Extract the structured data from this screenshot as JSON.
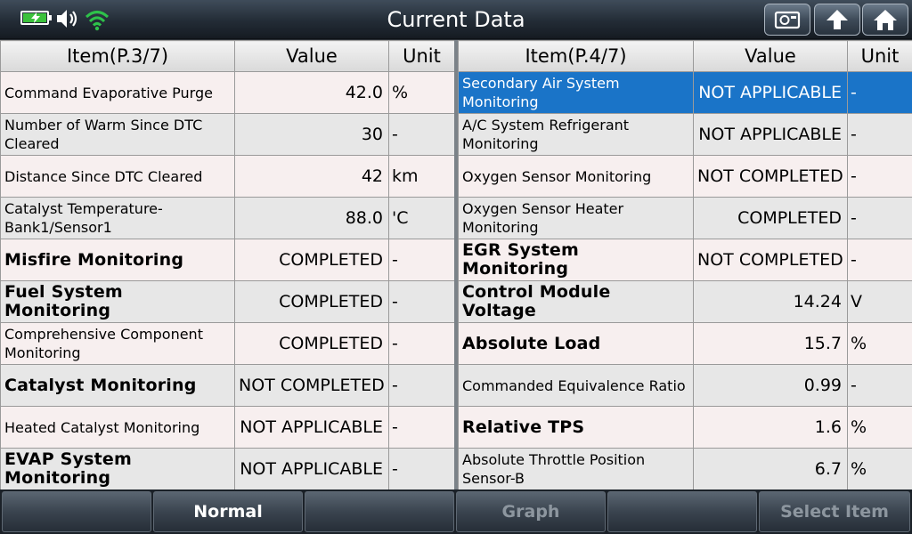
{
  "title": "Current Data",
  "status_icons": {
    "battery": "battery-charging-icon",
    "speaker": "speaker-icon",
    "wifi": "wifi-icon"
  },
  "toolbar_icons": [
    "camera-icon",
    "up-arrow-icon",
    "home-icon"
  ],
  "colors": {
    "selected_row": "#1a74c8",
    "battery_fill": "#3cc23c",
    "wifi": "#2ec24a"
  },
  "left_table": {
    "headers": {
      "item": "Item(P.3/7)",
      "value": "Value",
      "unit": "Unit"
    },
    "rows": [
      {
        "item": "Command Evaporative Purge",
        "value": "42.0",
        "unit": "%"
      },
      {
        "item": "Number of Warm Since DTC Cleared",
        "value": "30",
        "unit": "-"
      },
      {
        "item": "Distance Since DTC Cleared",
        "value": "42",
        "unit": "km"
      },
      {
        "item": "Catalyst Temperature-Bank1/Sensor1",
        "value": "88.0",
        "unit": "'C"
      },
      {
        "item": "Misfire Monitoring",
        "value": "COMPLETED",
        "unit": "-"
      },
      {
        "item": "Fuel System Monitoring",
        "value": "COMPLETED",
        "unit": "-"
      },
      {
        "item": "Comprehensive Component Monitoring",
        "value": "COMPLETED",
        "unit": "-"
      },
      {
        "item": "Catalyst Monitoring",
        "value": "NOT COMPLETED",
        "unit": "-"
      },
      {
        "item": "Heated Catalyst Monitoring",
        "value": "NOT APPLICABLE",
        "unit": "-"
      },
      {
        "item": "EVAP System Monitoring",
        "value": "NOT APPLICABLE",
        "unit": "-"
      }
    ]
  },
  "right_table": {
    "headers": {
      "item": "Item(P.4/7)",
      "value": "Value",
      "unit": "Unit"
    },
    "rows": [
      {
        "item": "Secondary Air System Monitoring",
        "value": "NOT APPLICABLE",
        "unit": "-"
      },
      {
        "item": "A/C System Refrigerant Monitoring",
        "value": "NOT APPLICABLE",
        "unit": "-"
      },
      {
        "item": "Oxygen Sensor Monitoring",
        "value": "NOT COMPLETED",
        "unit": "-"
      },
      {
        "item": "Oxygen Sensor Heater Monitoring",
        "value": "COMPLETED",
        "unit": "-"
      },
      {
        "item": "EGR System Monitoring",
        "value": "NOT COMPLETED",
        "unit": "-"
      },
      {
        "item": "Control Module Voltage",
        "value": "14.24",
        "unit": "V"
      },
      {
        "item": "Absolute Load",
        "value": "15.7",
        "unit": "%"
      },
      {
        "item": "Commanded Equivalence Ratio",
        "value": "0.99",
        "unit": "-"
      },
      {
        "item": "Relative TPS",
        "value": "1.6",
        "unit": "%"
      },
      {
        "item": "Absolute Throttle Position Sensor-B",
        "value": "6.7",
        "unit": "%"
      }
    ]
  },
  "bottom_bar": {
    "buttons": [
      "",
      "Normal",
      "",
      "Graph",
      "",
      "Select Item"
    ]
  }
}
